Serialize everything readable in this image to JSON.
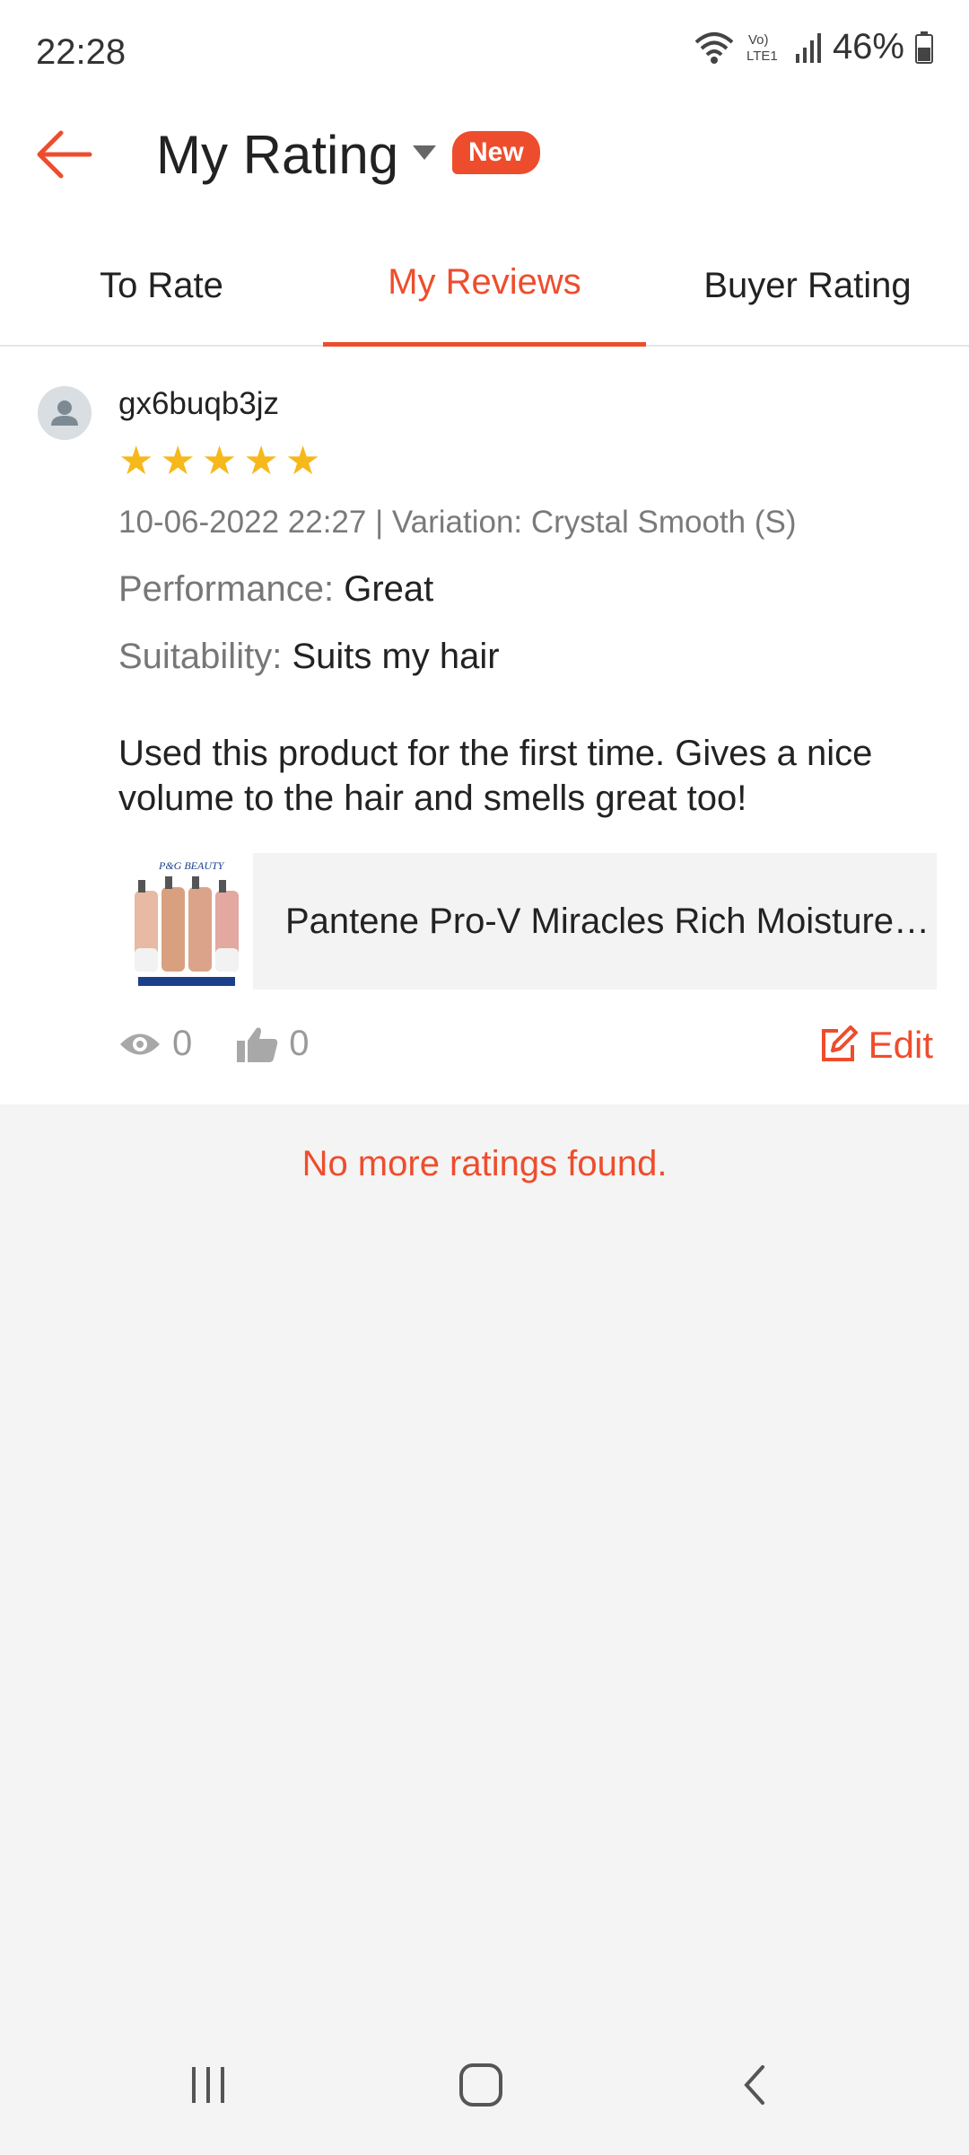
{
  "status": {
    "time": "22:28",
    "battery": "46%",
    "network": "Vo) LTE1"
  },
  "header": {
    "title": "My Rating",
    "badge": "New"
  },
  "tabs": [
    {
      "label": "To Rate",
      "active": false
    },
    {
      "label": "My Reviews",
      "active": true
    },
    {
      "label": "Buyer Rating",
      "active": false
    }
  ],
  "review": {
    "username": "gx6buqb3jz",
    "rating": 5,
    "meta": "10-06-2022 22:27 | Variation: Crystal Smooth (S)",
    "performance_key": "Performance:",
    "performance_val": "Great",
    "suitability_key": "Suitability:",
    "suitability_val": "Suits my hair",
    "comment": "Used this product for the first time. Gives a nice volume to the hair and smells great too!",
    "product_name": "Pantene Pro-V Miracles Rich Moisture Smooth Shampoo & Conditioner",
    "thumb_logo": "P&G BEAUTY",
    "views": "0",
    "likes": "0",
    "edit_label": "Edit"
  },
  "footer": {
    "no_more": "No more ratings found."
  },
  "colors": {
    "accent": "#ee4d2d",
    "star": "#f6b81a"
  }
}
